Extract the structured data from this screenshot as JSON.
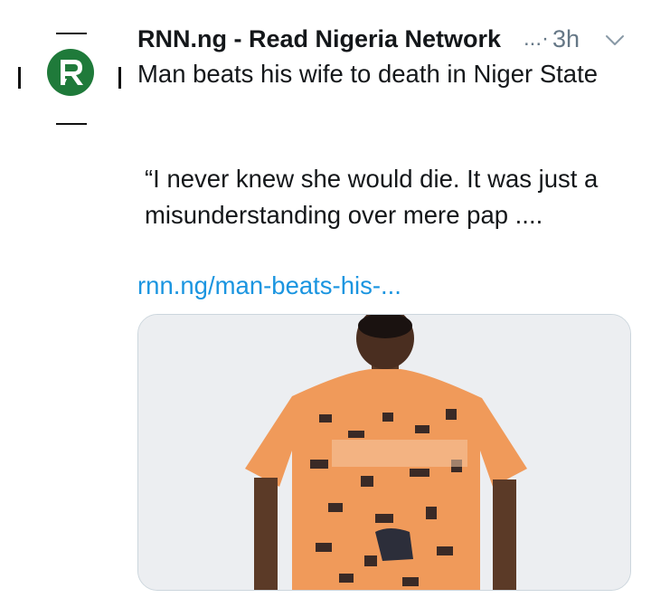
{
  "tweet": {
    "author": "RNN.ng - Read Nigeria Network",
    "author_overflow": "...·",
    "time": "3h",
    "headline": "Man beats his wife to death in Niger State",
    "quote": "“I never knew she would die. It was just a misunderstanding over mere pap ....",
    "link": "rnn.ng/man-beats-his-..."
  },
  "icons": {
    "avatar": "rnn-logo-icon",
    "menu": "chevron-down-icon"
  },
  "colors": {
    "link": "#1b95e0",
    "muted": "#657786",
    "text": "#14171a",
    "logo_green": "#1f7a3a",
    "shirt_orange": "#f09a5a",
    "background": "#ffffff"
  }
}
